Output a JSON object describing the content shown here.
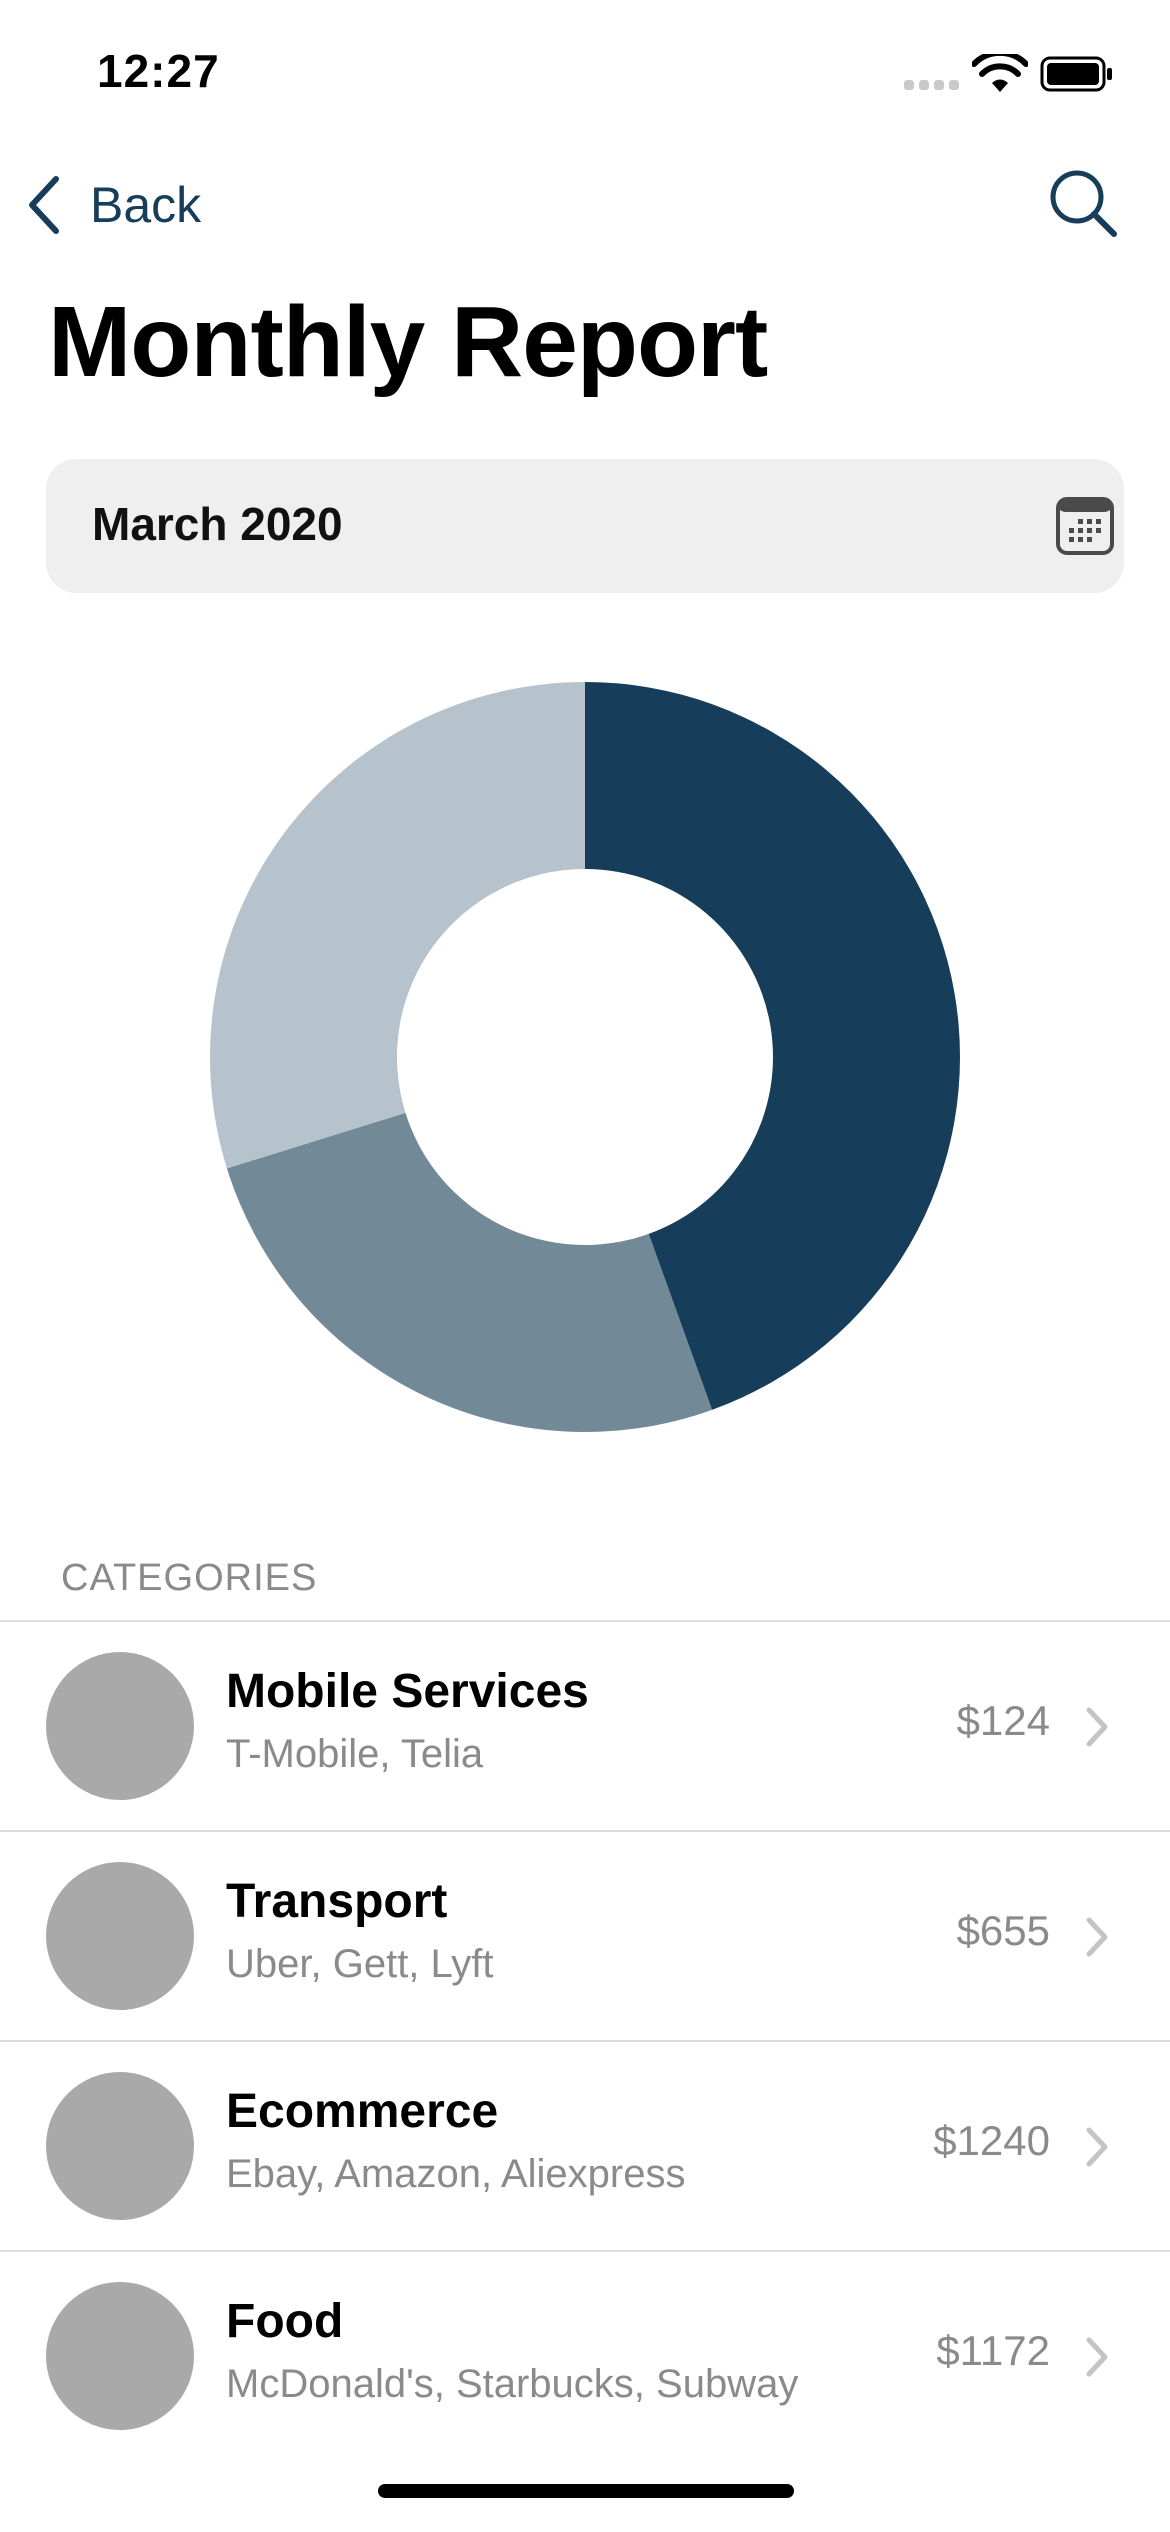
{
  "status_bar": {
    "time": "12:27"
  },
  "nav": {
    "back_label": "Back"
  },
  "page_title": "Monthly Report",
  "date_picker": {
    "value": "March 2020"
  },
  "colors": {
    "accent": "#163d5a",
    "slice_dark": "#163d5a",
    "slice_mid": "#728a98",
    "slice_light": "#b6c3cc",
    "avatar": "#a9a9a9"
  },
  "chart_data": {
    "type": "pie",
    "donut": true,
    "series": [
      {
        "values": [
          44.5,
          25.7,
          29.8
        ]
      }
    ],
    "colors": [
      "#163d5a",
      "#728a98",
      "#b6c3cc"
    ]
  },
  "categories": {
    "header": "CATEGORIES",
    "items": [
      {
        "title": "Mobile Services",
        "subtitle": "T-Mobile, Telia",
        "amount": "$124"
      },
      {
        "title": "Transport",
        "subtitle": "Uber, Gett, Lyft",
        "amount": "$655"
      },
      {
        "title": "Ecommerce",
        "subtitle": "Ebay, Amazon, Aliexpress",
        "amount": "$1240"
      },
      {
        "title": "Food",
        "subtitle": "McDonald's, Starbucks, Subway",
        "amount": "$1172"
      }
    ]
  },
  "icons": {
    "back": "chevron-left-icon",
    "search": "search-icon",
    "calendar": "calendar-icon",
    "row_disclosure": "chevron-right-icon"
  }
}
